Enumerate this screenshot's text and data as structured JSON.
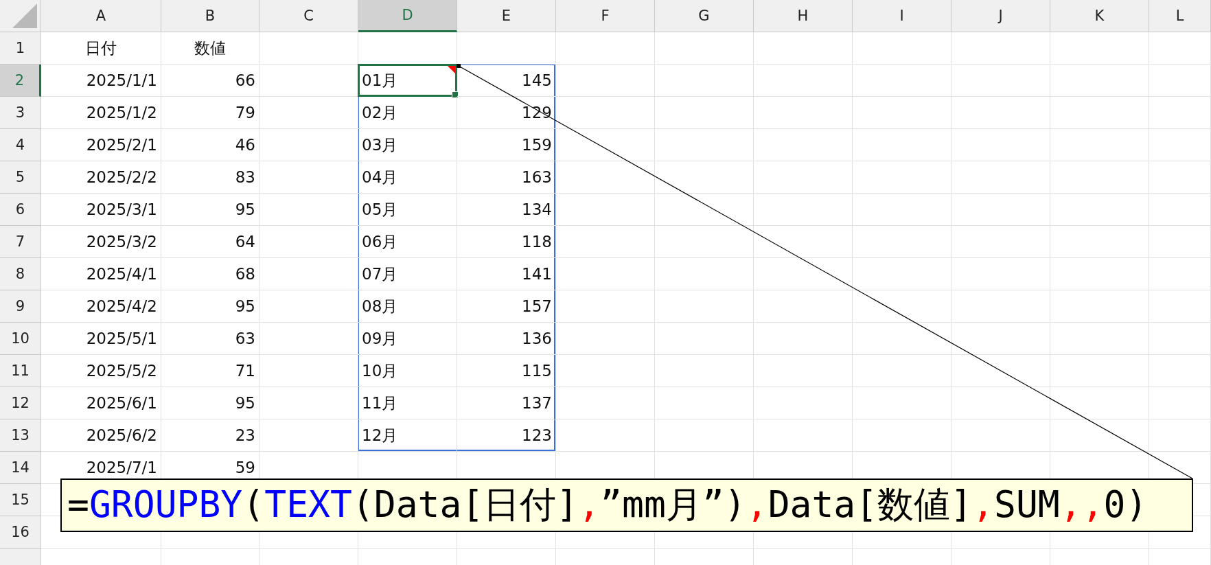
{
  "columns": [
    {
      "label": "A",
      "selected": false
    },
    {
      "label": "B",
      "selected": false
    },
    {
      "label": "C",
      "selected": false
    },
    {
      "label": "D",
      "selected": true
    },
    {
      "label": "E",
      "selected": false
    },
    {
      "label": "F",
      "selected": false
    },
    {
      "label": "G",
      "selected": false
    },
    {
      "label": "H",
      "selected": false
    },
    {
      "label": "I",
      "selected": false
    },
    {
      "label": "J",
      "selected": false
    },
    {
      "label": "K",
      "selected": false
    },
    {
      "label": "L",
      "selected": false
    }
  ],
  "rows": [
    {
      "label": "1",
      "selected": false,
      "kind": "header",
      "cells": [
        "日付",
        "数値",
        null,
        null,
        null
      ]
    },
    {
      "label": "2",
      "selected": true,
      "kind": "data",
      "cells": [
        "2025/1/1",
        "66",
        null,
        {
          "text": "01月",
          "active": true,
          "comment": true
        },
        "145"
      ]
    },
    {
      "label": "3",
      "selected": false,
      "kind": "data",
      "cells": [
        "2025/1/2",
        "79",
        null,
        "02月",
        "129"
      ]
    },
    {
      "label": "4",
      "selected": false,
      "kind": "data",
      "cells": [
        "2025/2/1",
        "46",
        null,
        "03月",
        "159"
      ]
    },
    {
      "label": "5",
      "selected": false,
      "kind": "data",
      "cells": [
        "2025/2/2",
        "83",
        null,
        "04月",
        "163"
      ]
    },
    {
      "label": "6",
      "selected": false,
      "kind": "data",
      "cells": [
        "2025/3/1",
        "95",
        null,
        "05月",
        "134"
      ]
    },
    {
      "label": "7",
      "selected": false,
      "kind": "data",
      "cells": [
        "2025/3/2",
        "64",
        null,
        "06月",
        "118"
      ]
    },
    {
      "label": "8",
      "selected": false,
      "kind": "data",
      "cells": [
        "2025/4/1",
        "68",
        null,
        "07月",
        "141"
      ]
    },
    {
      "label": "9",
      "selected": false,
      "kind": "data",
      "cells": [
        "2025/4/2",
        "95",
        null,
        "08月",
        "157"
      ]
    },
    {
      "label": "10",
      "selected": false,
      "kind": "data",
      "cells": [
        "2025/5/1",
        "63",
        null,
        "09月",
        "136"
      ]
    },
    {
      "label": "11",
      "selected": false,
      "kind": "data",
      "cells": [
        "2025/5/2",
        "71",
        null,
        "10月",
        "115"
      ]
    },
    {
      "label": "12",
      "selected": false,
      "kind": "data",
      "cells": [
        "2025/6/1",
        "95",
        null,
        "11月",
        "137"
      ]
    },
    {
      "label": "13",
      "selected": false,
      "kind": "data",
      "cells": [
        "2025/6/2",
        "23",
        null,
        "12月",
        "123"
      ]
    },
    {
      "label": "14",
      "selected": false,
      "kind": "data",
      "cells": [
        "2025/7/1",
        "59",
        null,
        null,
        null
      ]
    },
    {
      "label": "15",
      "selected": false,
      "kind": "data",
      "cells": [
        null,
        null,
        null,
        null,
        null
      ]
    },
    {
      "label": "16",
      "selected": false,
      "kind": "data",
      "cells": [
        null,
        null,
        null,
        null,
        null
      ]
    }
  ],
  "comment": {
    "segments": [
      {
        "text": "=",
        "color": "#000000"
      },
      {
        "text": "GROUPBY",
        "color": "#0000ff"
      },
      {
        "text": "(",
        "color": "#000000"
      },
      {
        "text": "TEXT",
        "color": "#0000ff"
      },
      {
        "text": "(Data[日付]",
        "color": "#000000"
      },
      {
        "text": ",",
        "color": "#ff0000"
      },
      {
        "text": "”mm月”)",
        "color": "#000000"
      },
      {
        "text": ",",
        "color": "#ff0000"
      },
      {
        "text": "Data[数値]",
        "color": "#000000"
      },
      {
        "text": ",",
        "color": "#ff0000"
      },
      {
        "text": "SUM",
        "color": "#000000"
      },
      {
        "text": ",,",
        "color": "#ff0000"
      },
      {
        "text": "0)",
        "color": "#000000"
      }
    ]
  }
}
